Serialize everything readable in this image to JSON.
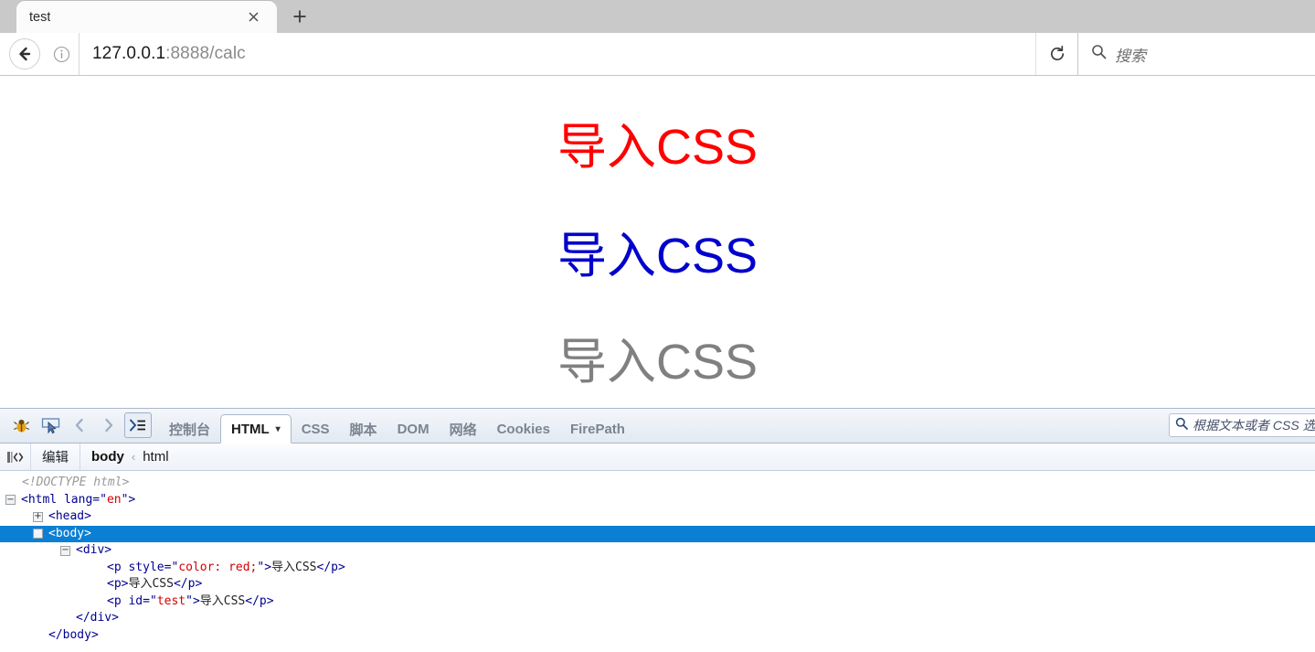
{
  "browser": {
    "tab": {
      "title": "test",
      "close_icon": "close-icon"
    },
    "newtab_icon": "plus-icon",
    "back_icon": "back-arrow-icon",
    "identity_icon": "info-icon",
    "url": {
      "host": "127.0.0.1",
      "rest": ":8888/calc"
    },
    "reload_icon": "reload-icon",
    "search": {
      "icon": "search-icon",
      "placeholder": "搜索"
    }
  },
  "page": {
    "headings": [
      {
        "text": "导入CSS",
        "color": "#ff0000"
      },
      {
        "text": "导入CSS",
        "color": "#0000cc"
      },
      {
        "text": "导入CSS",
        "color": "#808080"
      }
    ]
  },
  "firebug": {
    "icons": [
      {
        "name": "firebug-bug-icon"
      },
      {
        "name": "inspect-element-icon"
      },
      {
        "name": "chevron-left-icon"
      },
      {
        "name": "chevron-right-icon"
      },
      {
        "name": "command-line-icon"
      }
    ],
    "tabs": [
      {
        "label": "控制台",
        "active": false
      },
      {
        "label": "HTML",
        "active": true,
        "caret": "▾"
      },
      {
        "label": "CSS",
        "active": false
      },
      {
        "label": "脚本",
        "active": false
      },
      {
        "label": "DOM",
        "active": false
      },
      {
        "label": "网络",
        "active": false
      },
      {
        "label": "Cookies",
        "active": false
      },
      {
        "label": "FirePath",
        "active": false
      }
    ],
    "search": {
      "icon": "search-icon",
      "placeholder": "根据文本或者 CSS 选"
    },
    "breadcrumb": {
      "icon": "code-view-icon",
      "edit_label": "编辑",
      "node": "body",
      "separator": "‹",
      "parent": "html"
    },
    "dom": {
      "doctype": "<!DOCTYPE html>",
      "html_open_pre": "<html",
      "html_attr_name": " lang=",
      "html_attr_q1": "\"",
      "html_attr_value": "en",
      "html_attr_q2": "\"",
      "html_open_post": ">",
      "head_line": "<head>",
      "body_line": "<body>",
      "div_line": "<div>",
      "p1_pre": "<p",
      "p1_attr_name": " style=",
      "p1_q1": "\"",
      "p1_attr_value": "color: red;",
      "p1_q2": "\"",
      "p1_gt": ">",
      "p1_text": "导入CSS",
      "p1_close": "</p>",
      "p2_open": "<p>",
      "p2_text": "导入CSS",
      "p2_close": "</p>",
      "p3_pre": "<p",
      "p3_attr_name": " id=",
      "p3_q1": "\"",
      "p3_attr_value": "test",
      "p3_q2": "\"",
      "p3_gt": ">",
      "p3_text": "导入CSS",
      "p3_close": "</p>",
      "div_close": "</div>",
      "body_close": "</body>",
      "twisty_minus": "−",
      "twisty_plus": "+"
    }
  }
}
